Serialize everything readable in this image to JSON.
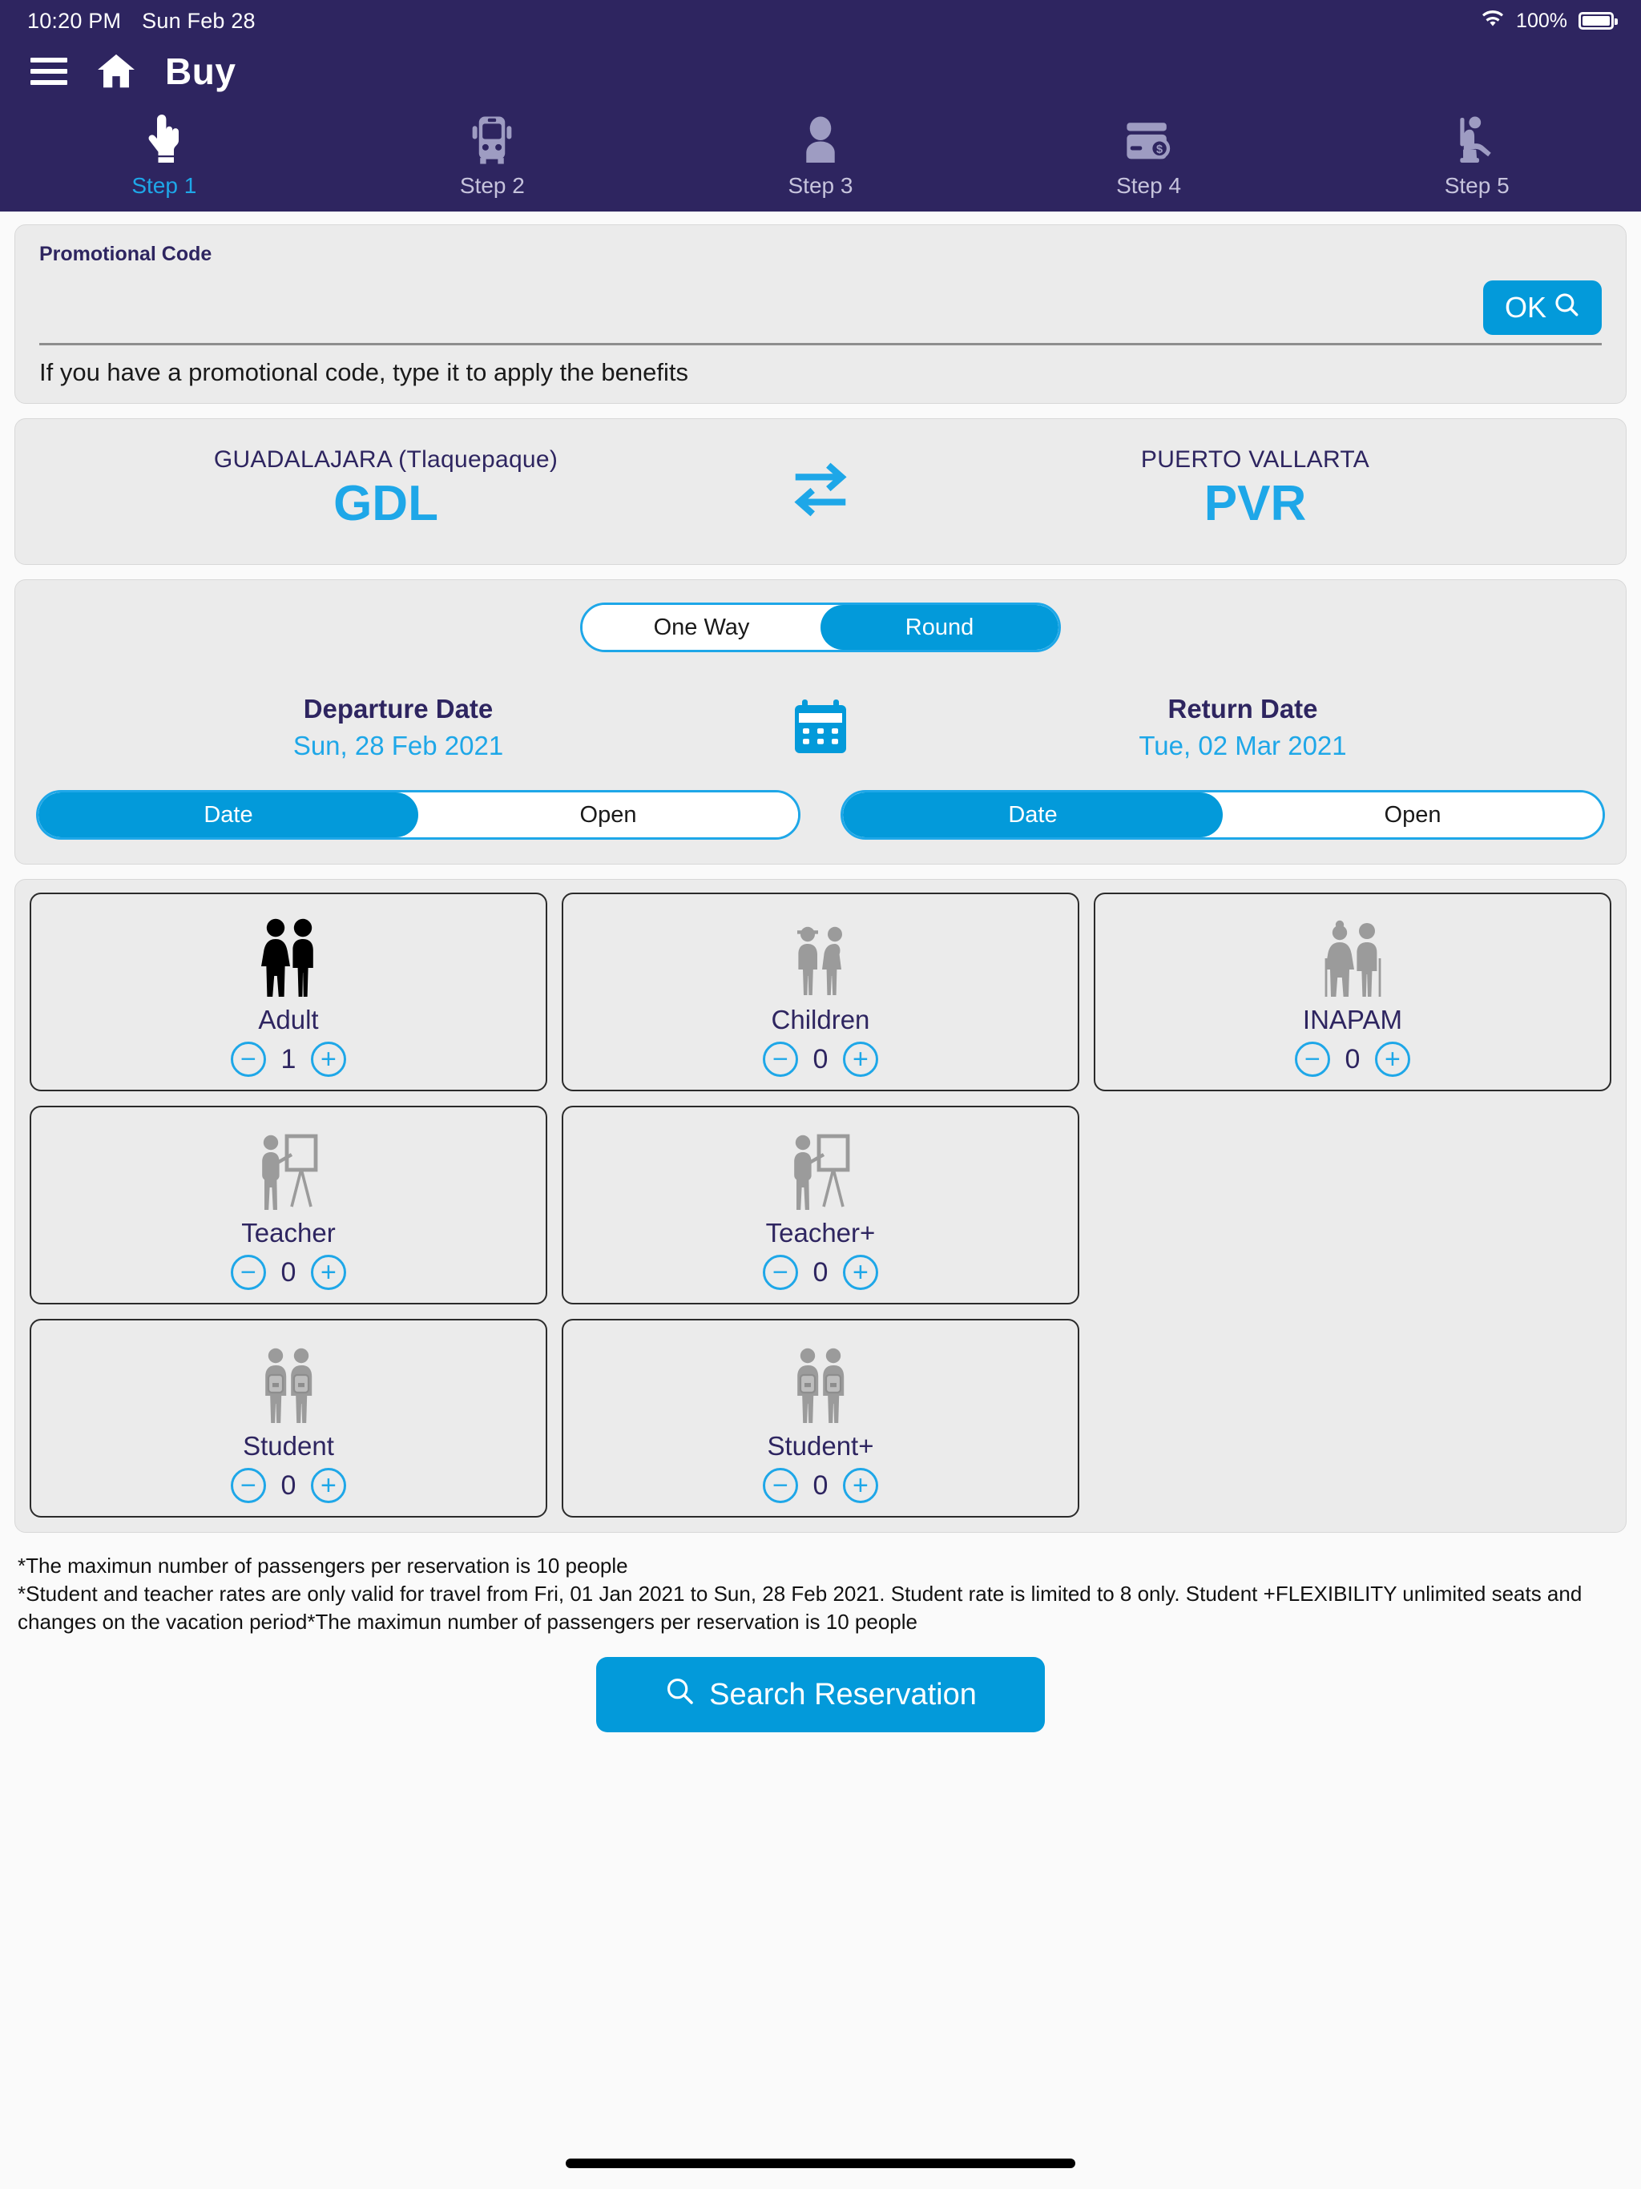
{
  "status_bar": {
    "time": "10:20 PM",
    "date": "Sun Feb 28",
    "wifi_icon": "wifi-icon",
    "battery_percent": "100%",
    "battery_icon": "battery-full-icon"
  },
  "app_bar": {
    "menu_icon": "hamburger-menu-icon",
    "home_icon": "home-icon",
    "title": "Buy"
  },
  "steps": [
    {
      "label": "Step 1",
      "icon": "tap-hand-icon",
      "active": true
    },
    {
      "label": "Step 2",
      "icon": "bus-icon",
      "active": false
    },
    {
      "label": "Step 3",
      "icon": "person-icon",
      "active": false
    },
    {
      "label": "Step 4",
      "icon": "payment-card-dollar-icon",
      "active": false
    },
    {
      "label": "Step 5",
      "icon": "seat-person-icon",
      "active": false
    }
  ],
  "promo": {
    "label": "Promotional Code",
    "value": "",
    "placeholder": "",
    "ok_label": "OK",
    "ok_icon": "search-icon",
    "hint": "If you have a promotional code, type it to apply the benefits"
  },
  "route": {
    "origin_city": "GUADALAJARA (Tlaquepaque)",
    "origin_code": "GDL",
    "swap_icon": "swap-arrows-icon",
    "destination_city": "PUERTO VALLARTA",
    "destination_code": "PVR"
  },
  "trip": {
    "types": [
      {
        "label": "One Way",
        "selected": false
      },
      {
        "label": "Round",
        "selected": true
      }
    ],
    "calendar_icon": "calendar-icon",
    "departure": {
      "title": "Departure Date",
      "value": "Sun, 28 Feb 2021",
      "modes": [
        {
          "label": "Date",
          "selected": true
        },
        {
          "label": "Open",
          "selected": false
        }
      ]
    },
    "return": {
      "title": "Return Date",
      "value": "Tue, 02 Mar 2021",
      "modes": [
        {
          "label": "Date",
          "selected": true
        },
        {
          "label": "Open",
          "selected": false
        }
      ]
    }
  },
  "passengers": [
    {
      "label": "Adult",
      "count": "1",
      "icon": "adult-couple-icon",
      "active": true,
      "decrement": "−",
      "increment": "+"
    },
    {
      "label": "Children",
      "count": "0",
      "icon": "children-icon",
      "active": false,
      "decrement": "−",
      "increment": "+"
    },
    {
      "label": "INAPAM",
      "count": "0",
      "icon": "senior-couple-icon",
      "active": false,
      "decrement": "−",
      "increment": "+"
    },
    {
      "label": "Teacher",
      "count": "0",
      "icon": "teacher-board-icon",
      "active": false,
      "decrement": "−",
      "increment": "+"
    },
    {
      "label": "Teacher+",
      "count": "0",
      "icon": "teacher-board-icon",
      "active": false,
      "decrement": "−",
      "increment": "+"
    },
    {
      "label": "Student",
      "count": "0",
      "icon": "student-backpack-icon",
      "active": false,
      "decrement": "−",
      "increment": "+"
    },
    {
      "label": "Student+",
      "count": "0",
      "icon": "student-backpack-icon",
      "active": false,
      "decrement": "−",
      "increment": "+"
    }
  ],
  "notes": {
    "line1": "*The maximun number of passengers per reservation is 10 people",
    "line2": "*Student and teacher rates are only valid for travel from Fri, 01 Jan 2021 to Sun, 28 Feb 2021. Student rate is limited to 8 only. Student +FLEXIBILITY unlimited seats and changes on the vacation period*The maximun number of passengers per reservation is 10 people"
  },
  "cta": {
    "label": "Search Reservation",
    "icon": "search-icon"
  },
  "colors": {
    "header_purple": "#2e2560",
    "accent_blue": "#039ada",
    "accent_cyan": "#1ea7e8",
    "panel_gray": "#ebebeb",
    "muted_step": "#c6c3dc"
  }
}
